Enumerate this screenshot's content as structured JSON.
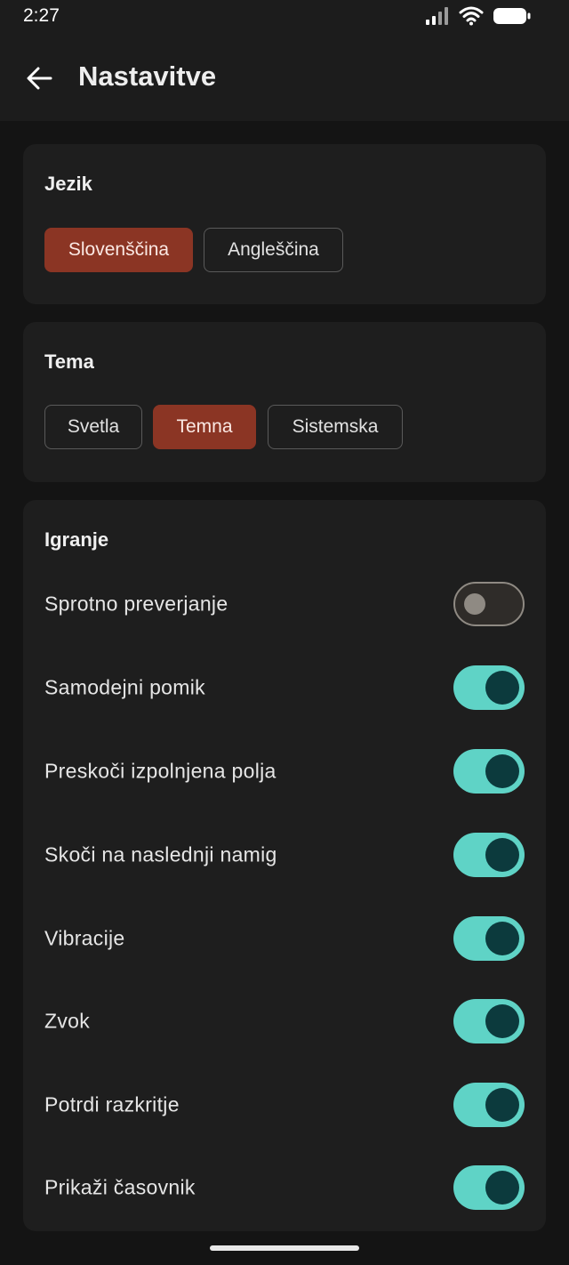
{
  "status_bar": {
    "time": "2:27"
  },
  "app_bar": {
    "title": "Nastavitve"
  },
  "language": {
    "title": "Jezik",
    "options": [
      {
        "label": "Slovenščina",
        "selected": true
      },
      {
        "label": "Angleščina",
        "selected": false
      }
    ]
  },
  "theme": {
    "title": "Tema",
    "options": [
      {
        "label": "Svetla",
        "selected": false
      },
      {
        "label": "Temna",
        "selected": true
      },
      {
        "label": "Sistemska",
        "selected": false
      }
    ]
  },
  "gameplay": {
    "title": "Igranje",
    "settings": [
      {
        "label": "Sprotno preverjanje",
        "on": false
      },
      {
        "label": "Samodejni pomik",
        "on": true
      },
      {
        "label": "Preskoči izpolnjena polja",
        "on": true
      },
      {
        "label": "Skoči na naslednji namig",
        "on": true
      },
      {
        "label": "Vibracije",
        "on": true
      },
      {
        "label": "Zvok",
        "on": true
      },
      {
        "label": "Potrdi razkritje",
        "on": true
      },
      {
        "label": "Prikaži časovnik",
        "on": true
      }
    ]
  },
  "colors": {
    "accent_selected": "#8b3524",
    "switch_on": "#5fd3c6",
    "switch_thumb_on": "#0c3a3d",
    "background": "#141414",
    "card": "#1e1e1e"
  }
}
